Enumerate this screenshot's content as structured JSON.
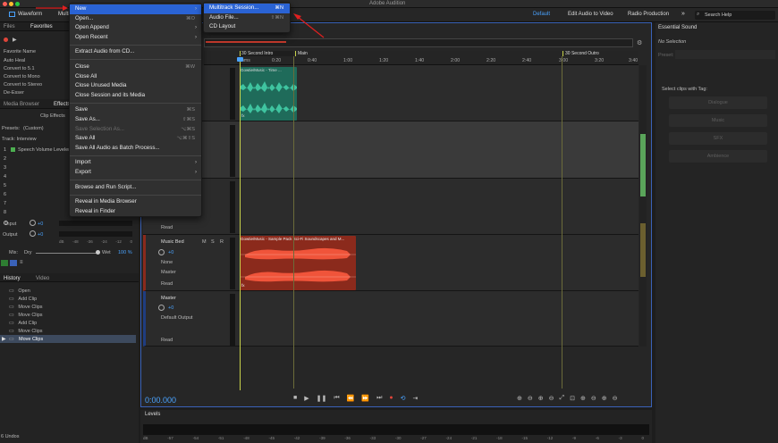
{
  "app": {
    "title": "Adobe Audition"
  },
  "toolbar": {
    "waveform": "Waveform",
    "multitrack": "Multi",
    "workspaces": [
      "Default",
      "Edit Audio to Video",
      "Radio Production"
    ],
    "more": "»",
    "search_placeholder": "Search Help"
  },
  "left": {
    "tabs": [
      "Files",
      "Favorites"
    ],
    "favorites": [
      "Favorite Name",
      "Auto Heal",
      "Convert to 5.1",
      "Convert to Mono",
      "Convert to Stereo",
      "De-Esser"
    ],
    "effect_tabs": [
      "Media Browser",
      "Effects"
    ],
    "clip_effects": "Clip Effects",
    "presets_label": "Presets:",
    "presets_value": "(Custom)",
    "track_label": "Track: Interview",
    "slots": [
      "1",
      "2",
      "3",
      "4",
      "5",
      "6",
      "7",
      "8"
    ],
    "slot1_name": "Speech Volume Leveler",
    "input_label": "Input",
    "output_label": "Output",
    "input_val": "+0",
    "output_val": "+0",
    "meter_scale": [
      "dB",
      "-48",
      "-36",
      "-24",
      "-12",
      "0"
    ],
    "mix": "Mix:",
    "dry": "Dry",
    "wet": "Wet",
    "mix_val": "100 %"
  },
  "history": {
    "tabs": [
      "History",
      "Video"
    ],
    "items": [
      "Open",
      "Add Clip",
      "Move Clips",
      "Move Clips",
      "Add Clip",
      "Move Clips",
      "Move Clips"
    ],
    "undo_count": "6 Undos"
  },
  "editor": {
    "timecode": "0:00.000",
    "ruler": [
      "hms",
      "0:20",
      "0:40",
      "1:00",
      "1:20",
      "1:40",
      "2:00",
      "2:20",
      "2:40",
      "3:00",
      "3:20",
      "3:40"
    ],
    "markers": [
      "30 Second Intro",
      "Main",
      "30 Second Outro"
    ]
  },
  "tracks": {
    "music_bed": "Music Bed",
    "master": "Master",
    "none": "None",
    "master_out": "Master",
    "default_output": "Default Output",
    "read": "Read",
    "m": "M",
    "s": "S",
    "r": "R",
    "zero": "+0",
    "clip1_title": "Gowtie/Music - Time ...",
    "clip2_title": "Gowtie/Music - Sample Pack Sci-Fi Soundscapes and M...",
    "clip_fx": "fx"
  },
  "menu_file": [
    {
      "label": "New",
      "arrow": true,
      "highlight": true
    },
    {
      "label": "Open...",
      "shortcut": "⌘O"
    },
    {
      "label": "Open Append",
      "arrow": true
    },
    {
      "label": "Open Recent",
      "arrow": true
    },
    {
      "sep": true
    },
    {
      "label": "Extract Audio from CD..."
    },
    {
      "sep": true
    },
    {
      "label": "Close",
      "shortcut": "⌘W"
    },
    {
      "label": "Close All"
    },
    {
      "label": "Close Unused Media"
    },
    {
      "label": "Close Session and its Media"
    },
    {
      "sep": true
    },
    {
      "label": "Save",
      "shortcut": "⌘S"
    },
    {
      "label": "Save As...",
      "shortcut": "⇧⌘S"
    },
    {
      "label": "Save Selection As...",
      "shortcut": "⌥⌘S",
      "disabled": true
    },
    {
      "label": "Save All",
      "shortcut": "⌥⌘⇧S"
    },
    {
      "label": "Save All Audio as Batch Process..."
    },
    {
      "sep": true
    },
    {
      "label": "Import",
      "arrow": true
    },
    {
      "label": "Export",
      "arrow": true
    },
    {
      "sep": true
    },
    {
      "label": "Browse and Run Script..."
    },
    {
      "sep": true
    },
    {
      "label": "Reveal in Media Browser"
    },
    {
      "label": "Reveal in Finder"
    }
  ],
  "menu_new": [
    {
      "label": "Multitrack Session...",
      "shortcut": "⌘N",
      "highlight": true
    },
    {
      "label": "Audio File...",
      "shortcut": "⇧⌘N"
    },
    {
      "label": "CD Layout"
    }
  ],
  "essential": {
    "title": "Essential Sound",
    "no_selection": "No Selection",
    "preset": "Preset:",
    "hint": "Select clips with Tag:",
    "buttons": [
      "Dialogue",
      "Music",
      "SFX",
      "Ambience"
    ]
  },
  "levels": {
    "title": "Levels",
    "scale": [
      "dB",
      "-57",
      "-54",
      "-51",
      "-48",
      "-45",
      "-42",
      "-39",
      "-36",
      "-33",
      "-30",
      "-27",
      "-24",
      "-21",
      "-18",
      "-15",
      "-12",
      "-9",
      "-6",
      "-3",
      "0"
    ]
  },
  "colors": {
    "accent": "#2a63d4",
    "clip_green": "#1f6b5a",
    "clip_red": "#8b2a1c",
    "wave_green": "#3fc4a0",
    "wave_red": "#f0543a",
    "playhead": "#c8d24a",
    "arrow_red": "#e02020"
  }
}
